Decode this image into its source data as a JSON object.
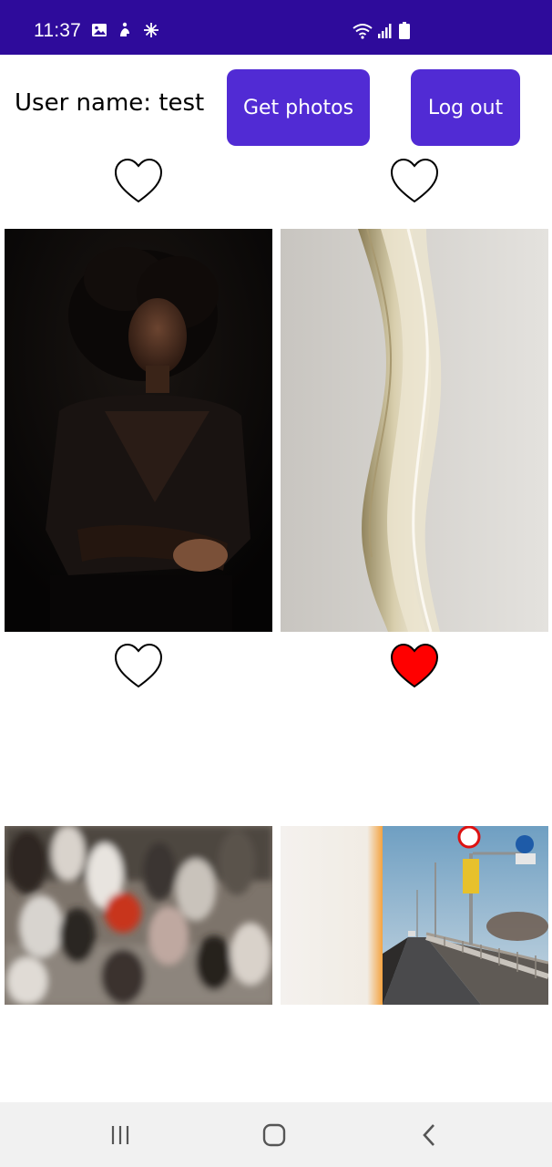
{
  "status_bar": {
    "time": "11:37",
    "icons": [
      "image-icon",
      "accessibility-icon",
      "spark-icon",
      "wifi-icon",
      "signal-icon",
      "battery-icon"
    ]
  },
  "header": {
    "user_label": "User name: test",
    "get_photos_label": "Get photos",
    "logout_label": "Log out"
  },
  "colors": {
    "status_bar": "#2e0b9b",
    "accent": "#512bd4",
    "liked_heart": "#ff0000"
  },
  "photos": [
    {
      "subject": "woman-portrait",
      "liked": false
    },
    {
      "subject": "beige-paper-waves",
      "liked": true
    },
    {
      "subject": "blurred-crowd",
      "liked": false
    },
    {
      "subject": "bridge-road",
      "liked": false
    }
  ],
  "top_hearts_liked": [
    false,
    false
  ],
  "nav_bar": [
    "recents-icon",
    "home-icon",
    "back-icon"
  ]
}
